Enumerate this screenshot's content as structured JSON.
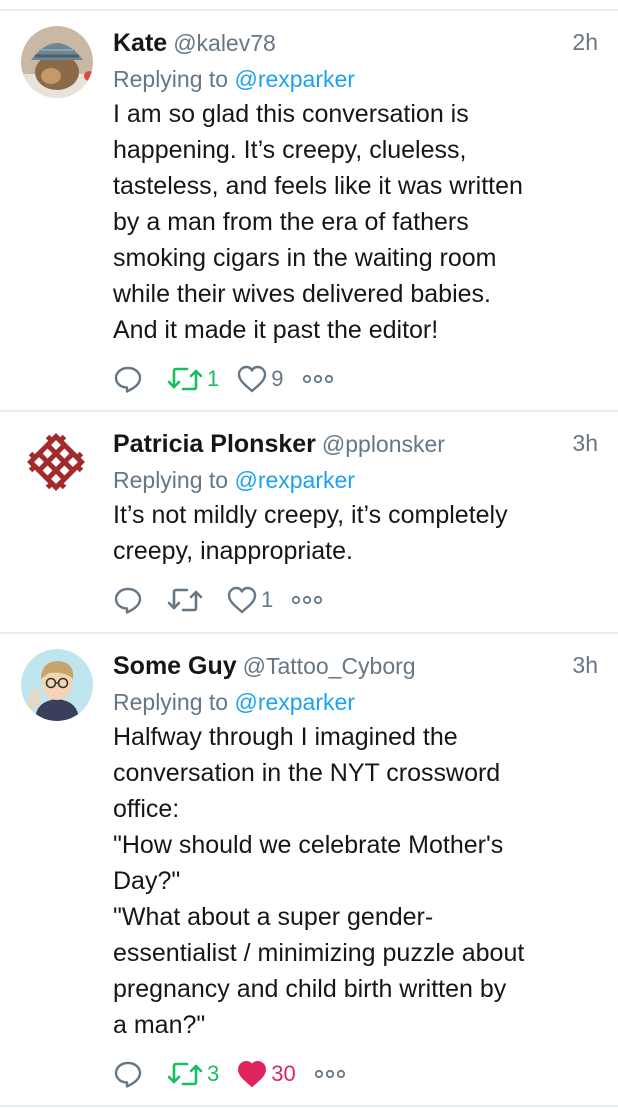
{
  "colors": {
    "reply_gray": "#657786",
    "retweet_green": "#17bf63",
    "like_red": "#e0245e",
    "link_blue": "#1da1f2"
  },
  "tweets": [
    {
      "name": "Kate",
      "handle": "@kalev78",
      "time": "2h",
      "replying_prefix": "Replying to",
      "replying_to": "@rexparker",
      "text": "I am so glad this conversation is\nhappening. It’s creepy, clueless,\ntasteless, and feels like it was written\nby a man from the era of fathers\nsmoking cigars in the waiting room\nwhile their wives delivered babies.\nAnd it made it past the editor!",
      "retweets": "1",
      "likes": "9",
      "retweeted": true,
      "liked": false,
      "avatar_icon": "knit-hat-cat-avatar"
    },
    {
      "name": "Patricia Plonsker",
      "handle": "@pplonsker",
      "time": "3h",
      "replying_prefix": "Replying to",
      "replying_to": "@rexparker",
      "text": "It’s not mildly creepy, it’s completely\ncreepy, inappropriate.",
      "retweets": "",
      "likes": "1",
      "retweeted": false,
      "liked": false,
      "avatar_icon": "red-knot-logo-avatar"
    },
    {
      "name": "Some Guy",
      "handle": "@Tattoo_Cyborg",
      "time": "3h",
      "replying_prefix": "Replying to",
      "replying_to": "@rexparker",
      "text": "Halfway through I imagined the\nconversation in the NYT crossword\noffice:\n\"How should we celebrate Mother's\nDay?\"\n\"What about a super gender-\nessentialist / minimizing puzzle about\npregnancy and child birth written by\na man?\"",
      "retweets": "3",
      "likes": "30",
      "retweeted": true,
      "liked": true,
      "avatar_icon": "cartoon-person-avatar"
    }
  ]
}
